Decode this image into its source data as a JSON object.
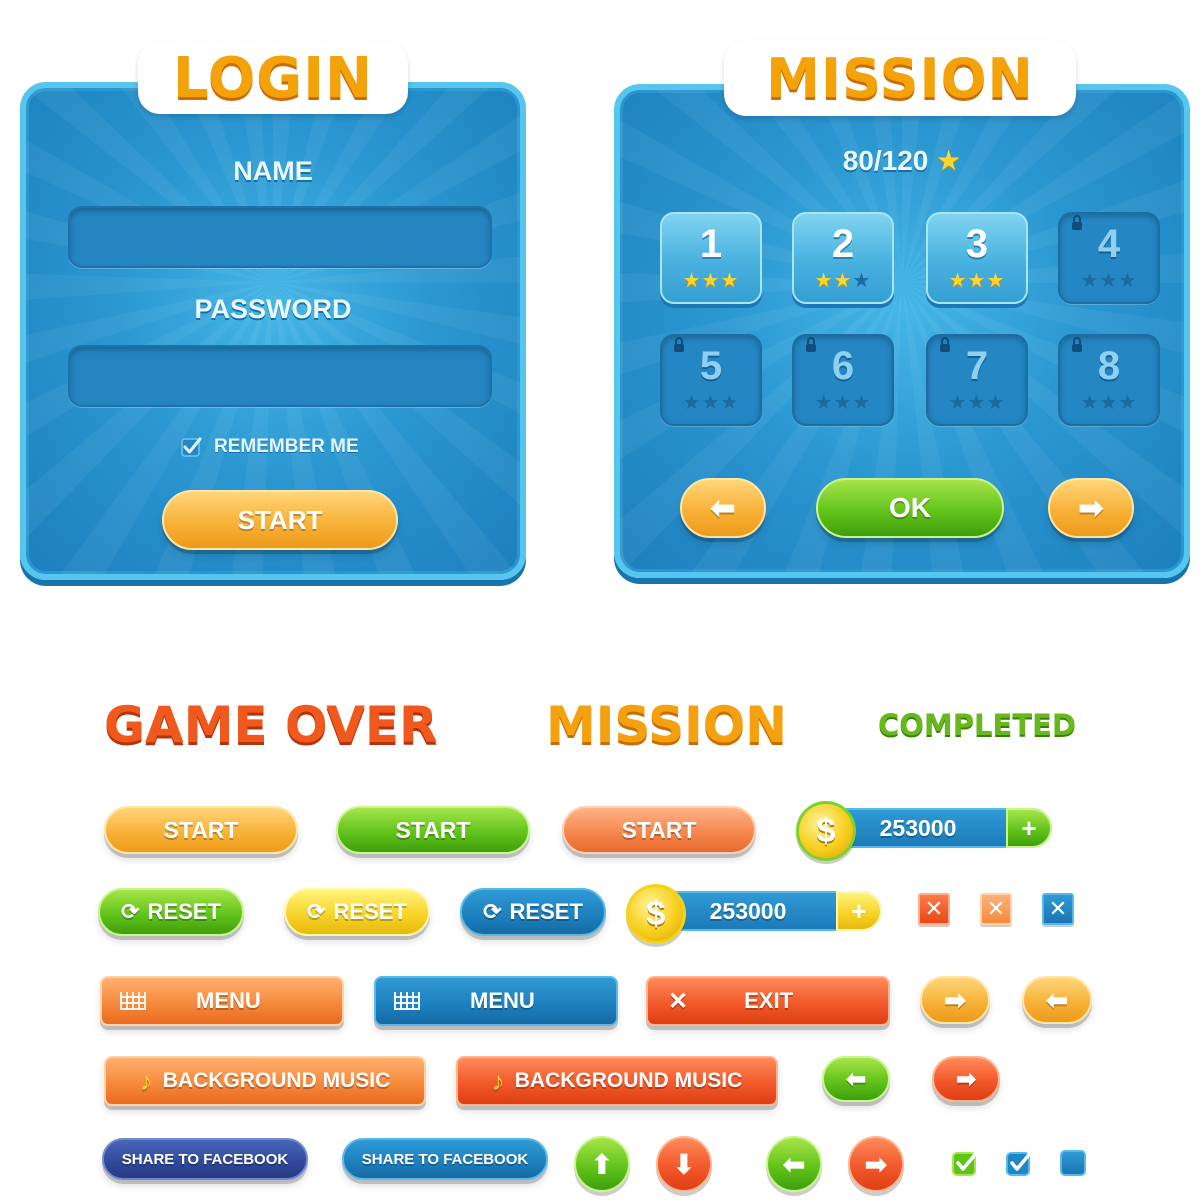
{
  "login": {
    "title": "LOGIN",
    "name_label": "NAME",
    "name_value": "",
    "password_label": "PASSWORD",
    "password_value": "",
    "remember_label": "REMEMBER ME",
    "remember_checked": true,
    "start_label": "START"
  },
  "mission_panel": {
    "title": "MISSION",
    "progress": "80/120",
    "levels": [
      {
        "num": "1",
        "stars": 3,
        "locked": false
      },
      {
        "num": "2",
        "stars": 2,
        "locked": false
      },
      {
        "num": "3",
        "stars": 3,
        "locked": false
      },
      {
        "num": "4",
        "stars": 0,
        "locked": true
      },
      {
        "num": "5",
        "stars": 0,
        "locked": true
      },
      {
        "num": "6",
        "stars": 0,
        "locked": true
      },
      {
        "num": "7",
        "stars": 0,
        "locked": true
      },
      {
        "num": "8",
        "stars": 0,
        "locked": true
      }
    ],
    "ok_label": "OK"
  },
  "titles": {
    "game_over": "GAME OVER",
    "mission": "MISSION",
    "completed": "COMPLETED"
  },
  "buttons": {
    "start": "START",
    "reset": "RESET",
    "menu": "MENU",
    "exit": "EXIT",
    "background_music": "BACKGROUND MUSIC",
    "share_facebook": "SHARE TO FACEBOOK"
  },
  "coins": {
    "amount_1": "253000",
    "amount_2": "253000",
    "symbol": "$",
    "plus": "+"
  },
  "colors": {
    "panel_blue": "#2b97d1",
    "orange": "#f7b238",
    "green": "#62c41b",
    "red": "#f2592a",
    "navy": "#31489a"
  }
}
